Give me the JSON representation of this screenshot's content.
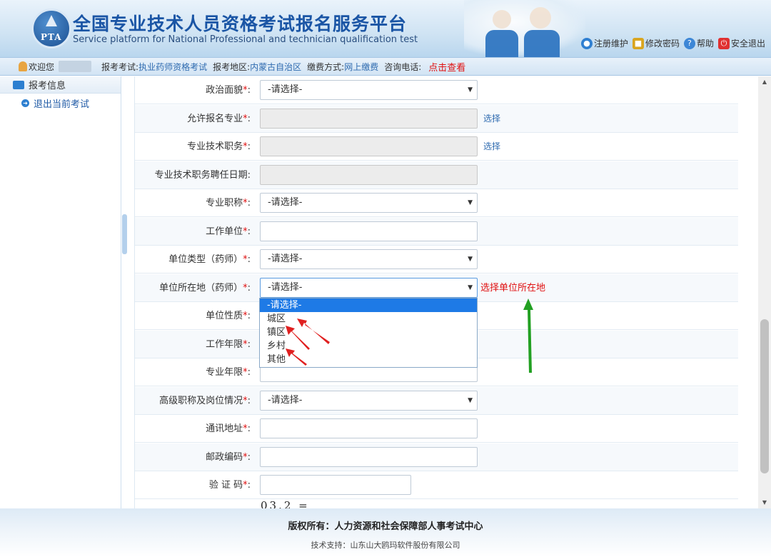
{
  "header": {
    "logo_text": "PTA",
    "title_cn": "全国专业技术人员资格考试报名服务平台",
    "title_en": "Service platform for National Professional and technician qualification test",
    "links": [
      {
        "label": "注册维护",
        "icon": "globe-icon",
        "color": "#2f7fd1"
      },
      {
        "label": "修改密码",
        "icon": "lock-icon",
        "color": "#d9a520"
      },
      {
        "label": "帮助",
        "icon": "help-icon",
        "color": "#3c86d6"
      },
      {
        "label": "安全退出",
        "icon": "power-icon",
        "color": "#e03030"
      }
    ]
  },
  "infobar": {
    "welcome": "欢迎您",
    "exam_label": "报考考试:",
    "exam_value": "执业药师资格考试",
    "region_label": "报考地区:",
    "region_value": "内蒙古自治区",
    "pay_label": "缴费方式:",
    "pay_value": "网上缴费",
    "phone_label": "咨询电话:",
    "phone_link": "点击查看"
  },
  "sidebar": {
    "section": "报考信息",
    "exit": "退出当前考试"
  },
  "form": {
    "required_mark": "*",
    "colon": ":",
    "choose": "选择",
    "rows": [
      {
        "label": "政治面貌",
        "required": true,
        "type": "select",
        "value": "-请选择-"
      },
      {
        "label": "允许报名专业",
        "required": true,
        "type": "disabled",
        "action": "选择"
      },
      {
        "label": "专业技术职务",
        "required": true,
        "type": "disabled",
        "action": "选择"
      },
      {
        "label": "专业技术职务聘任日期",
        "required": false,
        "type": "disabled"
      },
      {
        "label": "专业职称",
        "required": true,
        "type": "select",
        "value": "-请选择-"
      },
      {
        "label": "工作单位",
        "required": true,
        "type": "input"
      },
      {
        "label": "单位类型（药师）",
        "required": true,
        "type": "select",
        "value": "-请选择-"
      },
      {
        "label": "单位所在地（药师）",
        "required": true,
        "type": "select",
        "value": "-请选择-",
        "hint": "选择单位所在地"
      },
      {
        "label": "单位性质",
        "required": true,
        "type": "select",
        "value": "-请选择-"
      },
      {
        "label": "工作年限",
        "required": true,
        "type": "input"
      },
      {
        "label": "专业年限",
        "required": true,
        "type": "input"
      },
      {
        "label": "高级职称及岗位情况",
        "required": true,
        "type": "select",
        "value": "-请选择-"
      },
      {
        "label": "通讯地址",
        "required": true,
        "type": "input"
      },
      {
        "label": "邮政编码",
        "required": true,
        "type": "input"
      },
      {
        "label": "验 证 码",
        "required": true,
        "type": "captcha"
      }
    ],
    "captcha_text": "03.2 ="
  },
  "dropdown": {
    "options": [
      "-请选择-",
      "城区",
      "镇区",
      "乡村",
      "其他"
    ],
    "selected_index": 0
  },
  "footer": {
    "copyright": "版权所有：人力资源和社会保障部人事考试中心",
    "support": "技术支持：山东山大鸥玛软件股份有限公司"
  },
  "colors": {
    "brand": "#1a55a5",
    "link": "#2f6bb0",
    "required": "#e01010",
    "dropdown_highlight": "#1e7ae6",
    "annotation_red": "#e02020",
    "annotation_green": "#22a022"
  }
}
